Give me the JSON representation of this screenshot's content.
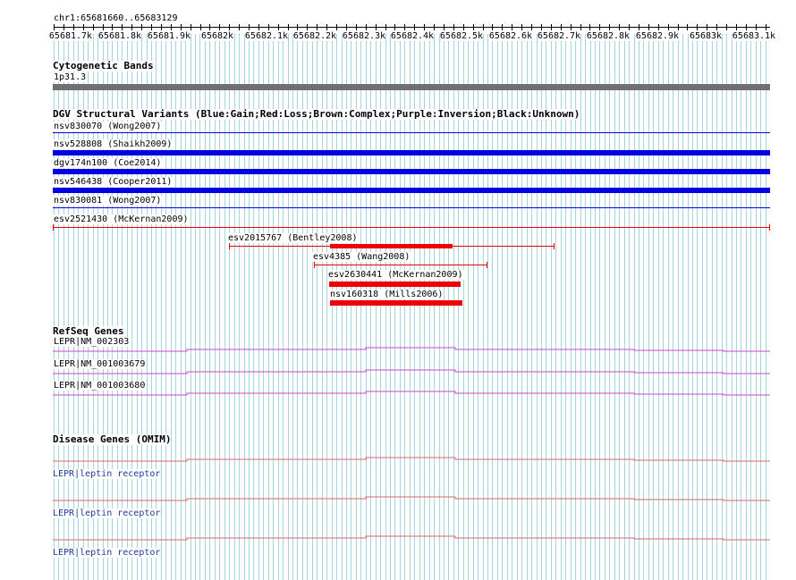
{
  "ruler": {
    "coords": "chr1:65681660..65683129",
    "ticks": [
      "65681.7k",
      "65681.8k",
      "65681.9k",
      "65682k",
      "65682.1k",
      "65682.2k",
      "65682.3k",
      "65682.4k",
      "65682.5k",
      "65682.6k",
      "65682.7k",
      "65682.8k",
      "65682.9k",
      "65683k",
      "65683.1k"
    ]
  },
  "cytobands": {
    "title": "Cytogenetic Bands",
    "band": "1p31.3"
  },
  "dgv": {
    "title": "DGV Structural Variants (Blue:Gain;Red:Loss;Brown:Complex;Purple:Inversion;Black:Unknown)",
    "variants": [
      "nsv830070 (Wong2007)",
      "nsv528808 (Shaikh2009)",
      "dgv174n100 (Coe2014)",
      "nsv546438 (Cooper2011)",
      "nsv830081 (Wong2007)",
      "esv2521430 (McKernan2009)",
      "esv2015767 (Bentley2008)",
      "esv4385 (Wang2008)",
      "esv2630441 (McKernan2009)",
      "nsv160318 (Mills2006)"
    ],
    "colors": {
      "gain": "#0000e0",
      "loss": "#ee0000"
    }
  },
  "refseq": {
    "title": "RefSeq Genes",
    "genes": [
      "LEPR|NM_002303",
      "LEPR|NM_001003679",
      "LEPR|NM_001003680"
    ],
    "color": "#cc44cc"
  },
  "omim": {
    "title": "Disease Genes (OMIM)",
    "genes": [
      "LEPR|leptin receptor",
      "LEPR|leptin receptor",
      "LEPR|leptin receptor"
    ],
    "color": "#dd6666"
  },
  "colors": {
    "grid": "#a8d4e0",
    "band": "#707070"
  }
}
